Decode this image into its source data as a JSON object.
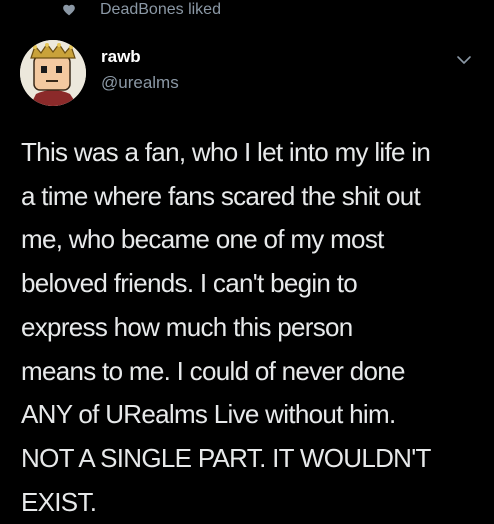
{
  "social_context": {
    "icon": "heart-icon",
    "text": "DeadBones liked"
  },
  "author": {
    "display_name": "rawb",
    "handle": "@urealms",
    "avatar": "cartoon-avatar-with-crown"
  },
  "menu": {
    "icon": "chevron-down-icon"
  },
  "tweet": {
    "lines": [
      "This was a fan, who I let into my life in",
      "a time where fans scared the shit out",
      "me, who became one of my most",
      "beloved friends. I can't begin to",
      "express how much this person",
      "means to me. I could of never done",
      "ANY of URealms Live without him.",
      "NOT A SINGLE PART. IT WOULDN'T",
      "EXIST."
    ]
  },
  "colors": {
    "background": "#000000",
    "text_primary": "#e7e9ea",
    "text_secondary": "#8b98a5"
  }
}
